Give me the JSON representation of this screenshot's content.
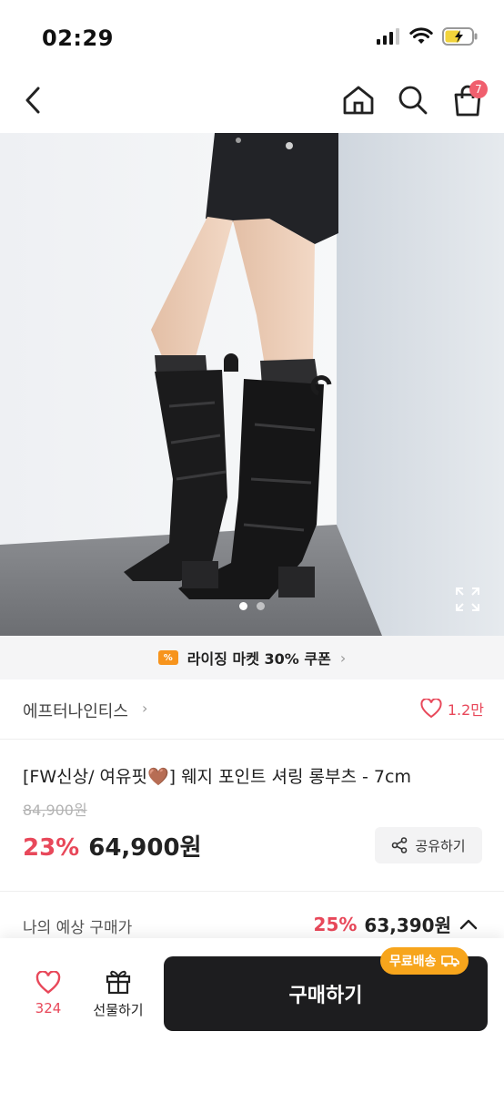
{
  "status": {
    "time": "02:29"
  },
  "nav": {
    "cart_count": "7"
  },
  "gallery": {
    "page_count": 2,
    "current_page": 1
  },
  "coupon": {
    "icon": "%",
    "text": "라이징 마켓 30% 쿠폰"
  },
  "brand": {
    "name": "에프터나인티스",
    "like_count": "1.2만"
  },
  "product": {
    "title": "[FW신상/ 여유핏🤎] 웨지 포인트 셔링 롱부츠 - 7cm",
    "original_price": "84,900원",
    "discount": "23%",
    "price": "64,900원",
    "share_label": "공유하기"
  },
  "expected": {
    "label": "나의 예상 구매가",
    "discount": "25%",
    "price": "63,390원"
  },
  "bottom": {
    "wish_count": "324",
    "gift_label": "선물하기",
    "buy_label": "구매하기",
    "free_ship": "무료배송"
  },
  "colors": {
    "accent": "#e8485a",
    "badge": "#f05f6e",
    "ship": "#f7a51c",
    "buy": "#1d1d1f"
  }
}
